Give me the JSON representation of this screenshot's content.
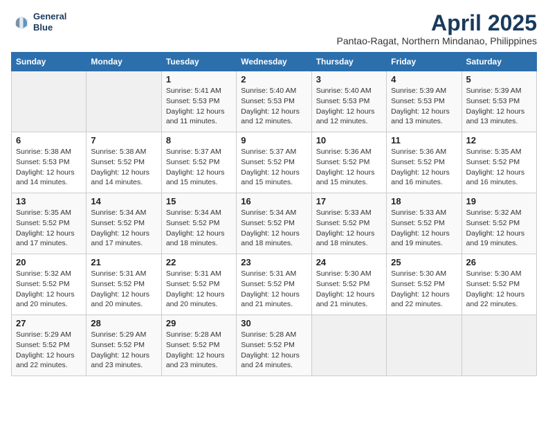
{
  "header": {
    "logo_line1": "General",
    "logo_line2": "Blue",
    "title": "April 2025",
    "subtitle": "Pantao-Ragat, Northern Mindanao, Philippines"
  },
  "calendar": {
    "days_of_week": [
      "Sunday",
      "Monday",
      "Tuesday",
      "Wednesday",
      "Thursday",
      "Friday",
      "Saturday"
    ],
    "weeks": [
      [
        {
          "day": "",
          "empty": true
        },
        {
          "day": "",
          "empty": true
        },
        {
          "day": "1",
          "sunrise": "Sunrise: 5:41 AM",
          "sunset": "Sunset: 5:53 PM",
          "daylight": "Daylight: 12 hours and 11 minutes."
        },
        {
          "day": "2",
          "sunrise": "Sunrise: 5:40 AM",
          "sunset": "Sunset: 5:53 PM",
          "daylight": "Daylight: 12 hours and 12 minutes."
        },
        {
          "day": "3",
          "sunrise": "Sunrise: 5:40 AM",
          "sunset": "Sunset: 5:53 PM",
          "daylight": "Daylight: 12 hours and 12 minutes."
        },
        {
          "day": "4",
          "sunrise": "Sunrise: 5:39 AM",
          "sunset": "Sunset: 5:53 PM",
          "daylight": "Daylight: 12 hours and 13 minutes."
        },
        {
          "day": "5",
          "sunrise": "Sunrise: 5:39 AM",
          "sunset": "Sunset: 5:53 PM",
          "daylight": "Daylight: 12 hours and 13 minutes."
        }
      ],
      [
        {
          "day": "6",
          "sunrise": "Sunrise: 5:38 AM",
          "sunset": "Sunset: 5:53 PM",
          "daylight": "Daylight: 12 hours and 14 minutes."
        },
        {
          "day": "7",
          "sunrise": "Sunrise: 5:38 AM",
          "sunset": "Sunset: 5:52 PM",
          "daylight": "Daylight: 12 hours and 14 minutes."
        },
        {
          "day": "8",
          "sunrise": "Sunrise: 5:37 AM",
          "sunset": "Sunset: 5:52 PM",
          "daylight": "Daylight: 12 hours and 15 minutes."
        },
        {
          "day": "9",
          "sunrise": "Sunrise: 5:37 AM",
          "sunset": "Sunset: 5:52 PM",
          "daylight": "Daylight: 12 hours and 15 minutes."
        },
        {
          "day": "10",
          "sunrise": "Sunrise: 5:36 AM",
          "sunset": "Sunset: 5:52 PM",
          "daylight": "Daylight: 12 hours and 15 minutes."
        },
        {
          "day": "11",
          "sunrise": "Sunrise: 5:36 AM",
          "sunset": "Sunset: 5:52 PM",
          "daylight": "Daylight: 12 hours and 16 minutes."
        },
        {
          "day": "12",
          "sunrise": "Sunrise: 5:35 AM",
          "sunset": "Sunset: 5:52 PM",
          "daylight": "Daylight: 12 hours and 16 minutes."
        }
      ],
      [
        {
          "day": "13",
          "sunrise": "Sunrise: 5:35 AM",
          "sunset": "Sunset: 5:52 PM",
          "daylight": "Daylight: 12 hours and 17 minutes."
        },
        {
          "day": "14",
          "sunrise": "Sunrise: 5:34 AM",
          "sunset": "Sunset: 5:52 PM",
          "daylight": "Daylight: 12 hours and 17 minutes."
        },
        {
          "day": "15",
          "sunrise": "Sunrise: 5:34 AM",
          "sunset": "Sunset: 5:52 PM",
          "daylight": "Daylight: 12 hours and 18 minutes."
        },
        {
          "day": "16",
          "sunrise": "Sunrise: 5:34 AM",
          "sunset": "Sunset: 5:52 PM",
          "daylight": "Daylight: 12 hours and 18 minutes."
        },
        {
          "day": "17",
          "sunrise": "Sunrise: 5:33 AM",
          "sunset": "Sunset: 5:52 PM",
          "daylight": "Daylight: 12 hours and 18 minutes."
        },
        {
          "day": "18",
          "sunrise": "Sunrise: 5:33 AM",
          "sunset": "Sunset: 5:52 PM",
          "daylight": "Daylight: 12 hours and 19 minutes."
        },
        {
          "day": "19",
          "sunrise": "Sunrise: 5:32 AM",
          "sunset": "Sunset: 5:52 PM",
          "daylight": "Daylight: 12 hours and 19 minutes."
        }
      ],
      [
        {
          "day": "20",
          "sunrise": "Sunrise: 5:32 AM",
          "sunset": "Sunset: 5:52 PM",
          "daylight": "Daylight: 12 hours and 20 minutes."
        },
        {
          "day": "21",
          "sunrise": "Sunrise: 5:31 AM",
          "sunset": "Sunset: 5:52 PM",
          "daylight": "Daylight: 12 hours and 20 minutes."
        },
        {
          "day": "22",
          "sunrise": "Sunrise: 5:31 AM",
          "sunset": "Sunset: 5:52 PM",
          "daylight": "Daylight: 12 hours and 20 minutes."
        },
        {
          "day": "23",
          "sunrise": "Sunrise: 5:31 AM",
          "sunset": "Sunset: 5:52 PM",
          "daylight": "Daylight: 12 hours and 21 minutes."
        },
        {
          "day": "24",
          "sunrise": "Sunrise: 5:30 AM",
          "sunset": "Sunset: 5:52 PM",
          "daylight": "Daylight: 12 hours and 21 minutes."
        },
        {
          "day": "25",
          "sunrise": "Sunrise: 5:30 AM",
          "sunset": "Sunset: 5:52 PM",
          "daylight": "Daylight: 12 hours and 22 minutes."
        },
        {
          "day": "26",
          "sunrise": "Sunrise: 5:30 AM",
          "sunset": "Sunset: 5:52 PM",
          "daylight": "Daylight: 12 hours and 22 minutes."
        }
      ],
      [
        {
          "day": "27",
          "sunrise": "Sunrise: 5:29 AM",
          "sunset": "Sunset: 5:52 PM",
          "daylight": "Daylight: 12 hours and 22 minutes."
        },
        {
          "day": "28",
          "sunrise": "Sunrise: 5:29 AM",
          "sunset": "Sunset: 5:52 PM",
          "daylight": "Daylight: 12 hours and 23 minutes."
        },
        {
          "day": "29",
          "sunrise": "Sunrise: 5:28 AM",
          "sunset": "Sunset: 5:52 PM",
          "daylight": "Daylight: 12 hours and 23 minutes."
        },
        {
          "day": "30",
          "sunrise": "Sunrise: 5:28 AM",
          "sunset": "Sunset: 5:52 PM",
          "daylight": "Daylight: 12 hours and 24 minutes."
        },
        {
          "day": "",
          "empty": true
        },
        {
          "day": "",
          "empty": true
        },
        {
          "day": "",
          "empty": true
        }
      ]
    ]
  }
}
